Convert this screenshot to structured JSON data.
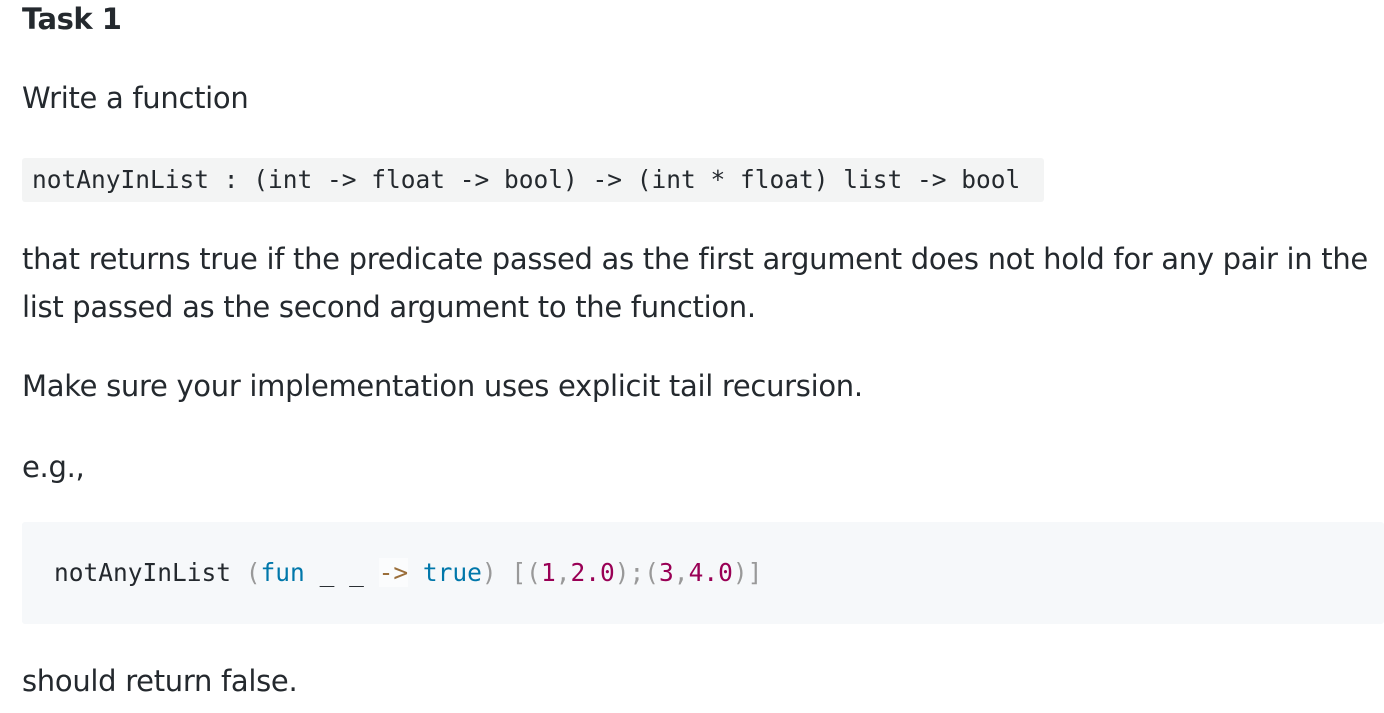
{
  "heading": "Task 1",
  "intro": "Write a function",
  "signature": "notAnyInList : (int -> float -> bool) -> (int * float) list -> bool",
  "description": "that returns true if the predicate passed as the first argument does not hold for any pair in the list passed as the second argument to the function.",
  "requirement": "Make sure your implementation uses explicit tail recursion.",
  "example_label": "e.g.,",
  "example_code": {
    "func": "notAnyInList",
    "space1": " ",
    "open_paren": "(",
    "kw_fun": "fun",
    "wildcards": " _ _ ",
    "arrow": "->",
    "space2": " ",
    "kw_true": "true",
    "close_paren": ")",
    "space3": " ",
    "open_bracket": "[",
    "open_t1": "(",
    "n1": "1",
    "comma1": ",",
    "n2": "2.0",
    "close_t1": ")",
    "semi": ";",
    "open_t2": "(",
    "n3": "3",
    "comma2": ",",
    "n4": "4.0",
    "close_t2": ")",
    "close_bracket": "]"
  },
  "conclusion": "should return false."
}
